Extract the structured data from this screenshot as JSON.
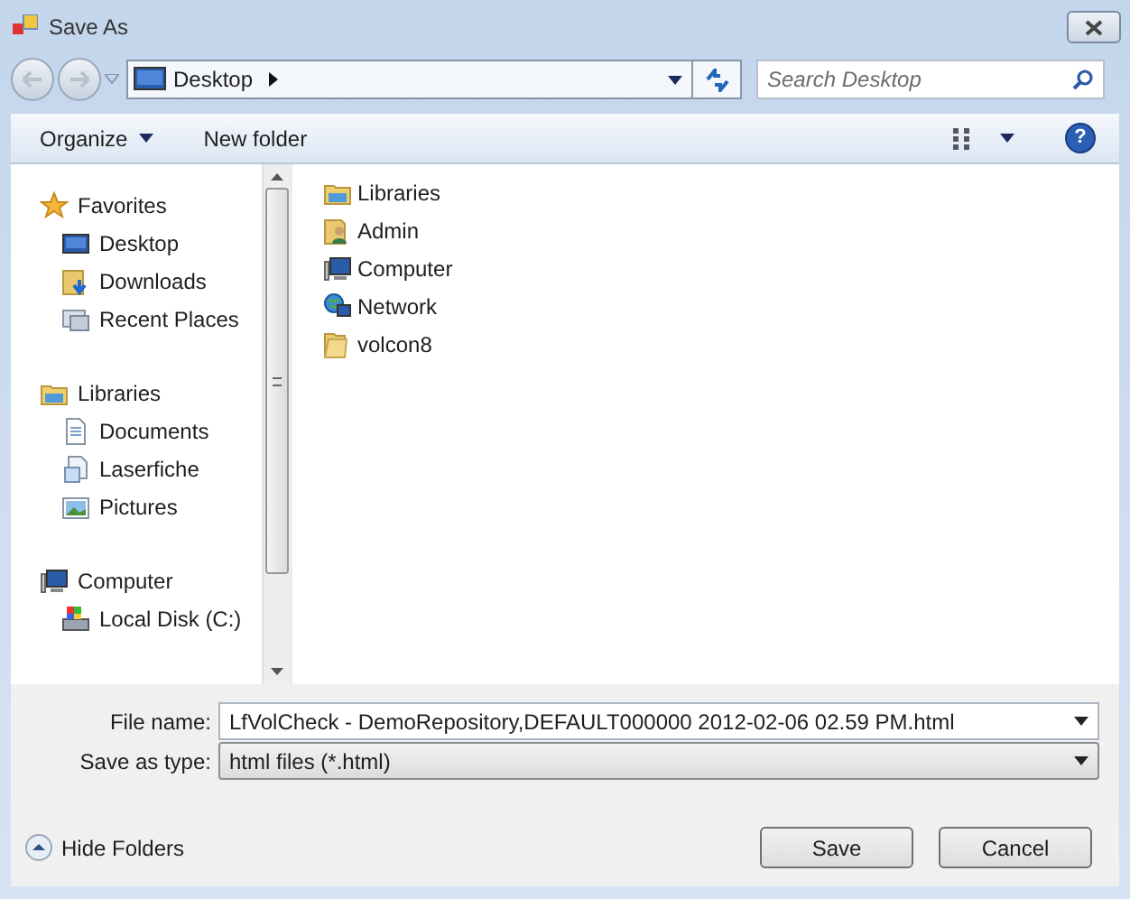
{
  "window": {
    "title": "Save As"
  },
  "address": {
    "location": "Desktop",
    "search_placeholder": "Search Desktop"
  },
  "toolbar": {
    "organize": "Organize",
    "new_folder": "New folder",
    "help": "?"
  },
  "nav_groups": [
    {
      "label": "Favorites",
      "kind": "favorites",
      "children": [
        {
          "label": "Desktop",
          "kind": "desktop"
        },
        {
          "label": "Downloads",
          "kind": "downloads"
        },
        {
          "label": "Recent Places",
          "kind": "recent"
        }
      ]
    },
    {
      "label": "Libraries",
      "kind": "libraries",
      "children": [
        {
          "label": "Documents",
          "kind": "documents"
        },
        {
          "label": "Laserfiche",
          "kind": "document"
        },
        {
          "label": "Pictures",
          "kind": "pictures"
        }
      ]
    },
    {
      "label": "Computer",
      "kind": "computer",
      "children": [
        {
          "label": "Local Disk (C:)",
          "kind": "disk"
        }
      ]
    }
  ],
  "items": [
    {
      "label": "Libraries",
      "kind": "libraries"
    },
    {
      "label": "Admin",
      "kind": "user"
    },
    {
      "label": "Computer",
      "kind": "computer"
    },
    {
      "label": "Network",
      "kind": "network"
    },
    {
      "label": "volcon8",
      "kind": "folder"
    }
  ],
  "file_name": {
    "label": "File name:",
    "value": "LfVolCheck - DemoRepository,DEFAULT000000 2012-02-06 02.59 PM.html"
  },
  "save_type": {
    "label": "Save as type:",
    "value": "html files (*.html)"
  },
  "hide_folders": "Hide Folders",
  "buttons": [
    "Save",
    "Cancel"
  ]
}
